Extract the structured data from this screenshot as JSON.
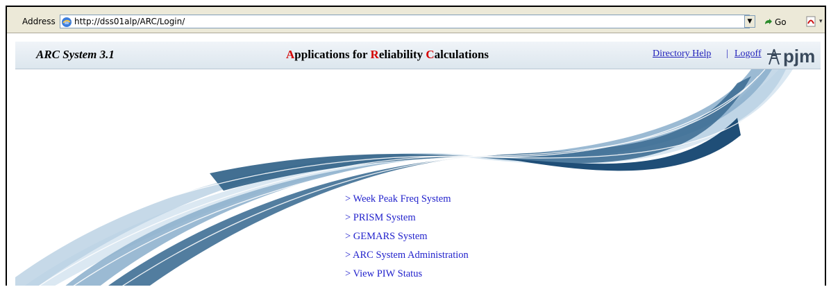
{
  "browser": {
    "address_label": "Address",
    "url": "http://dss01alp/ARC/Login/",
    "go_label": "Go",
    "go_icon": "go-arrow-icon",
    "page_icon": "ie-page-icon"
  },
  "header": {
    "system_title": "ARC System 3.1",
    "app_title_parts": [
      {
        "cap": "A",
        "rest": "pplications for "
      },
      {
        "cap": "R",
        "rest": "eliability "
      },
      {
        "cap": "C",
        "rest": "alculations"
      }
    ],
    "directory_help": "Directory Help",
    "separator": "|",
    "logoff": "Logoff",
    "logo_text": "pjm",
    "accent_color": "#d40000",
    "link_color": "#2222bb"
  },
  "menu": {
    "items": [
      "> Week Peak Freq System",
      "> PRISM System",
      "> GEMARS System",
      "> ARC System Administration",
      "> View PIW Status"
    ]
  }
}
